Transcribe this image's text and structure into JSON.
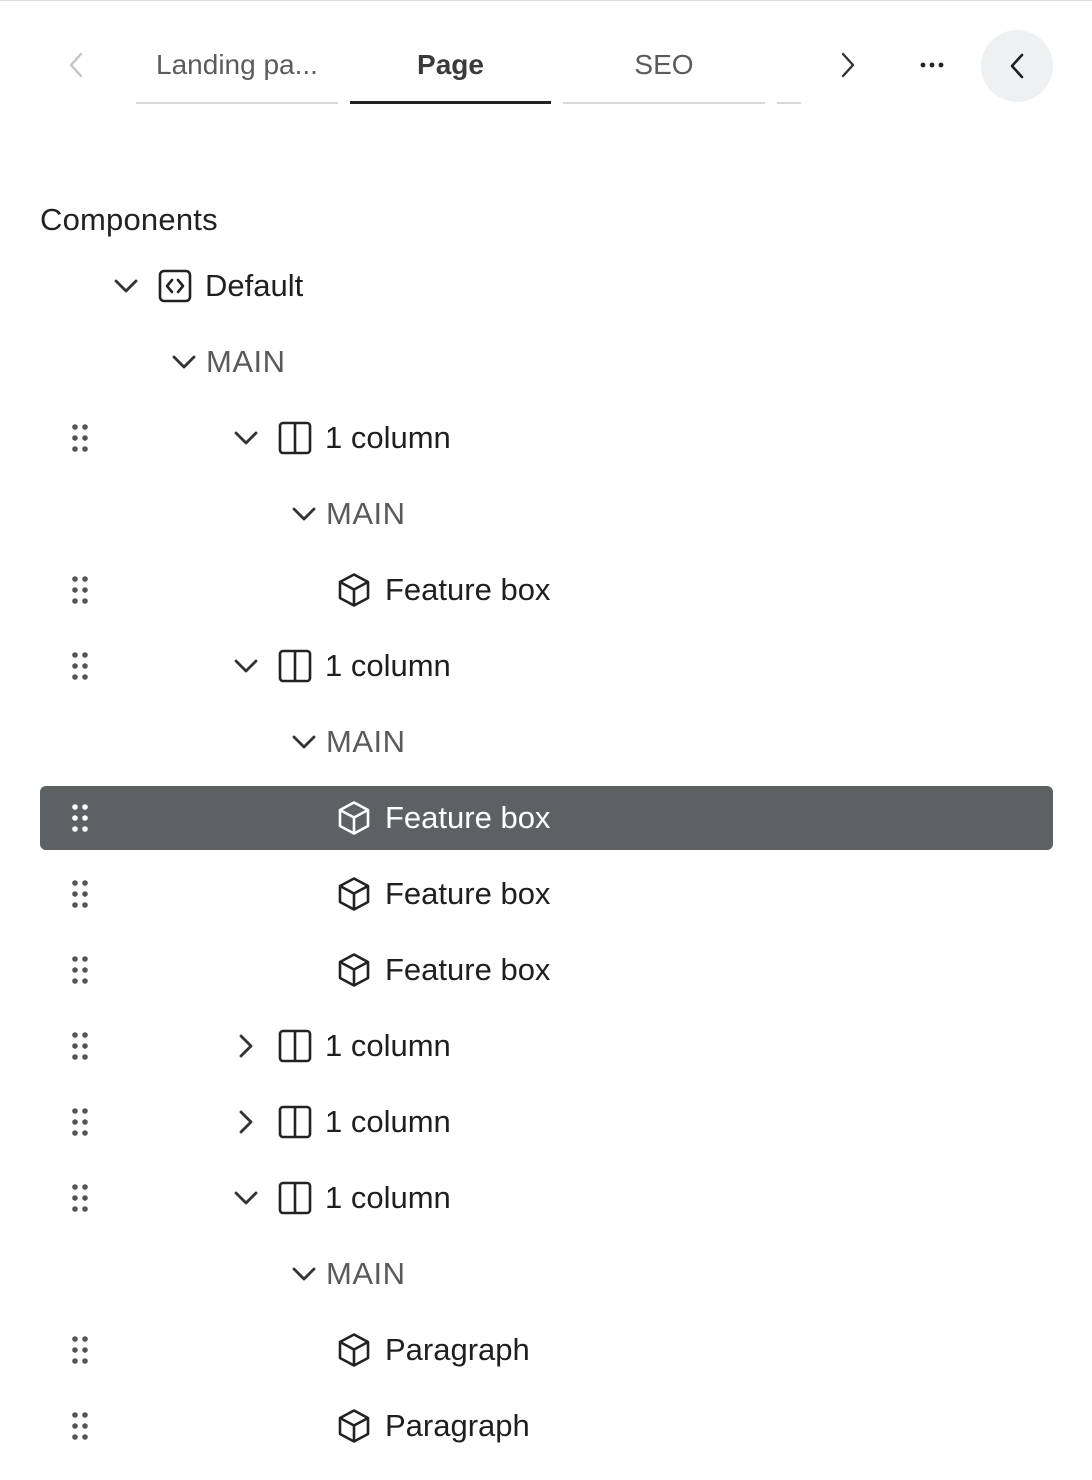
{
  "header": {
    "tabs": [
      {
        "label": "Landing pa...",
        "active": false
      },
      {
        "label": "Page",
        "active": true
      },
      {
        "label": "SEO",
        "active": false
      }
    ],
    "prev_icon": "chevron-left-icon",
    "next_icon": "chevron-right-icon",
    "more_icon": "ellipsis-icon",
    "collapse_icon": "chevron-left-icon"
  },
  "tree": {
    "title": "Components",
    "nodes": [
      {
        "label": "Default",
        "type": "layout",
        "icon": "code-icon",
        "expanded": true
      },
      {
        "label": "MAIN",
        "type": "slot",
        "expanded": true
      },
      {
        "label": "1 column",
        "type": "section",
        "icon": "columns-icon",
        "expanded": true
      },
      {
        "label": "MAIN",
        "type": "slot",
        "expanded": true
      },
      {
        "label": "Feature box",
        "type": "component",
        "icon": "cube-icon"
      },
      {
        "label": "1 column",
        "type": "section",
        "icon": "columns-icon",
        "expanded": true
      },
      {
        "label": "MAIN",
        "type": "slot",
        "expanded": true
      },
      {
        "label": "Feature box",
        "type": "component",
        "icon": "cube-icon",
        "selected": true
      },
      {
        "label": "Feature box",
        "type": "component",
        "icon": "cube-icon"
      },
      {
        "label": "Feature box",
        "type": "component",
        "icon": "cube-icon"
      },
      {
        "label": "1 column",
        "type": "section",
        "icon": "columns-icon",
        "expanded": false
      },
      {
        "label": "1 column",
        "type": "section",
        "icon": "columns-icon",
        "expanded": false
      },
      {
        "label": "1 column",
        "type": "section",
        "icon": "columns-icon",
        "expanded": true
      },
      {
        "label": "MAIN",
        "type": "slot",
        "expanded": true
      },
      {
        "label": "Paragraph",
        "type": "component",
        "icon": "cube-icon"
      },
      {
        "label": "Paragraph",
        "type": "component",
        "icon": "cube-icon"
      }
    ]
  },
  "colors": {
    "selected_row": "#5e6163",
    "active_tab_underline": "#222222",
    "collapse_button_bg": "#eef0f1"
  }
}
